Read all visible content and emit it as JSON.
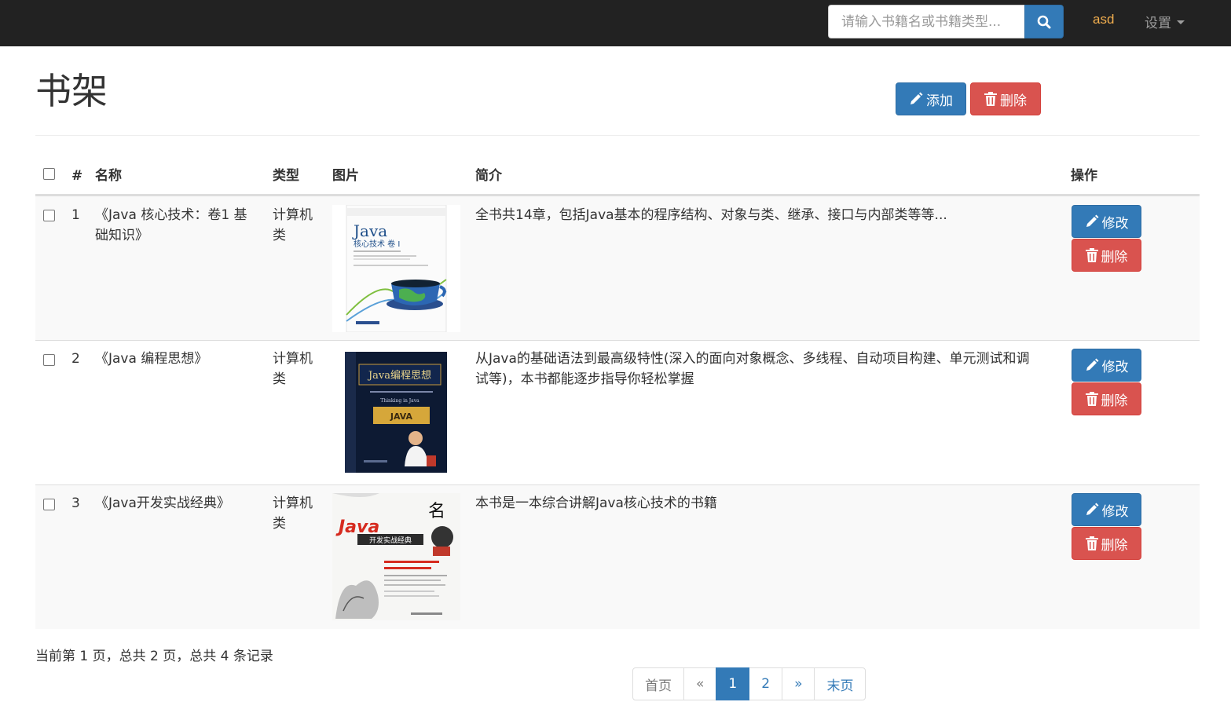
{
  "navbar": {
    "search_placeholder": "请输入书籍名或书籍类型...",
    "user": "asd",
    "settings": "设置"
  },
  "header": {
    "title": "书架",
    "add_label": "添加",
    "delete_label": "删除"
  },
  "table": {
    "columns": [
      "#",
      "名称",
      "类型",
      "图片",
      "简介",
      "操作"
    ],
    "rows": [
      {
        "id": "1",
        "name_line1": "《Java 核心技术：卷1 基",
        "name_line2": "础知识》",
        "type_line1": "计算机",
        "type_line2": "类",
        "cover": "Java 核心技术 卷I",
        "desc_line1": "全书共14章，包括Java基本的程序结构、对象与类、继承、接口与内部类等等...",
        "desc_line2": "",
        "edit_label": "修改",
        "delete_label": "删除"
      },
      {
        "id": "2",
        "name_line1": "《Java 编程思想》",
        "name_line2": "",
        "type_line1": "计算机",
        "type_line2": "类",
        "cover": "Java编程思想",
        "desc_line1": "从Java的基础语法到最高级特性(深入的面向对象概念、多线程、自动项目构建、单元测试和调",
        "desc_line2": "试等)，本书都能逐步指导你轻松掌握",
        "edit_label": "修改",
        "delete_label": "删除"
      },
      {
        "id": "3",
        "name_line1": "《Java开发实战经典》",
        "name_line2": "",
        "type_line1": "计算机",
        "type_line2": "类",
        "cover": "Java 开发实战经典",
        "desc_line1": "本书是一本综合讲解Java核心技术的书籍",
        "desc_line2": "",
        "edit_label": "修改",
        "delete_label": "删除"
      }
    ]
  },
  "footer": {
    "page_info": "当前第 1 页，总共 2 页，总共 4 条记录",
    "pagination": [
      "首页",
      "«",
      "1",
      "2",
      "»",
      "末页"
    ]
  },
  "colors": {
    "navbar_bg": "#222222",
    "primary": "#337ab7",
    "danger": "#d9534f",
    "user_accent": "#f0ad4e"
  },
  "icons": [
    "search-icon",
    "pencil-icon",
    "trash-icon",
    "caret-down-icon"
  ]
}
